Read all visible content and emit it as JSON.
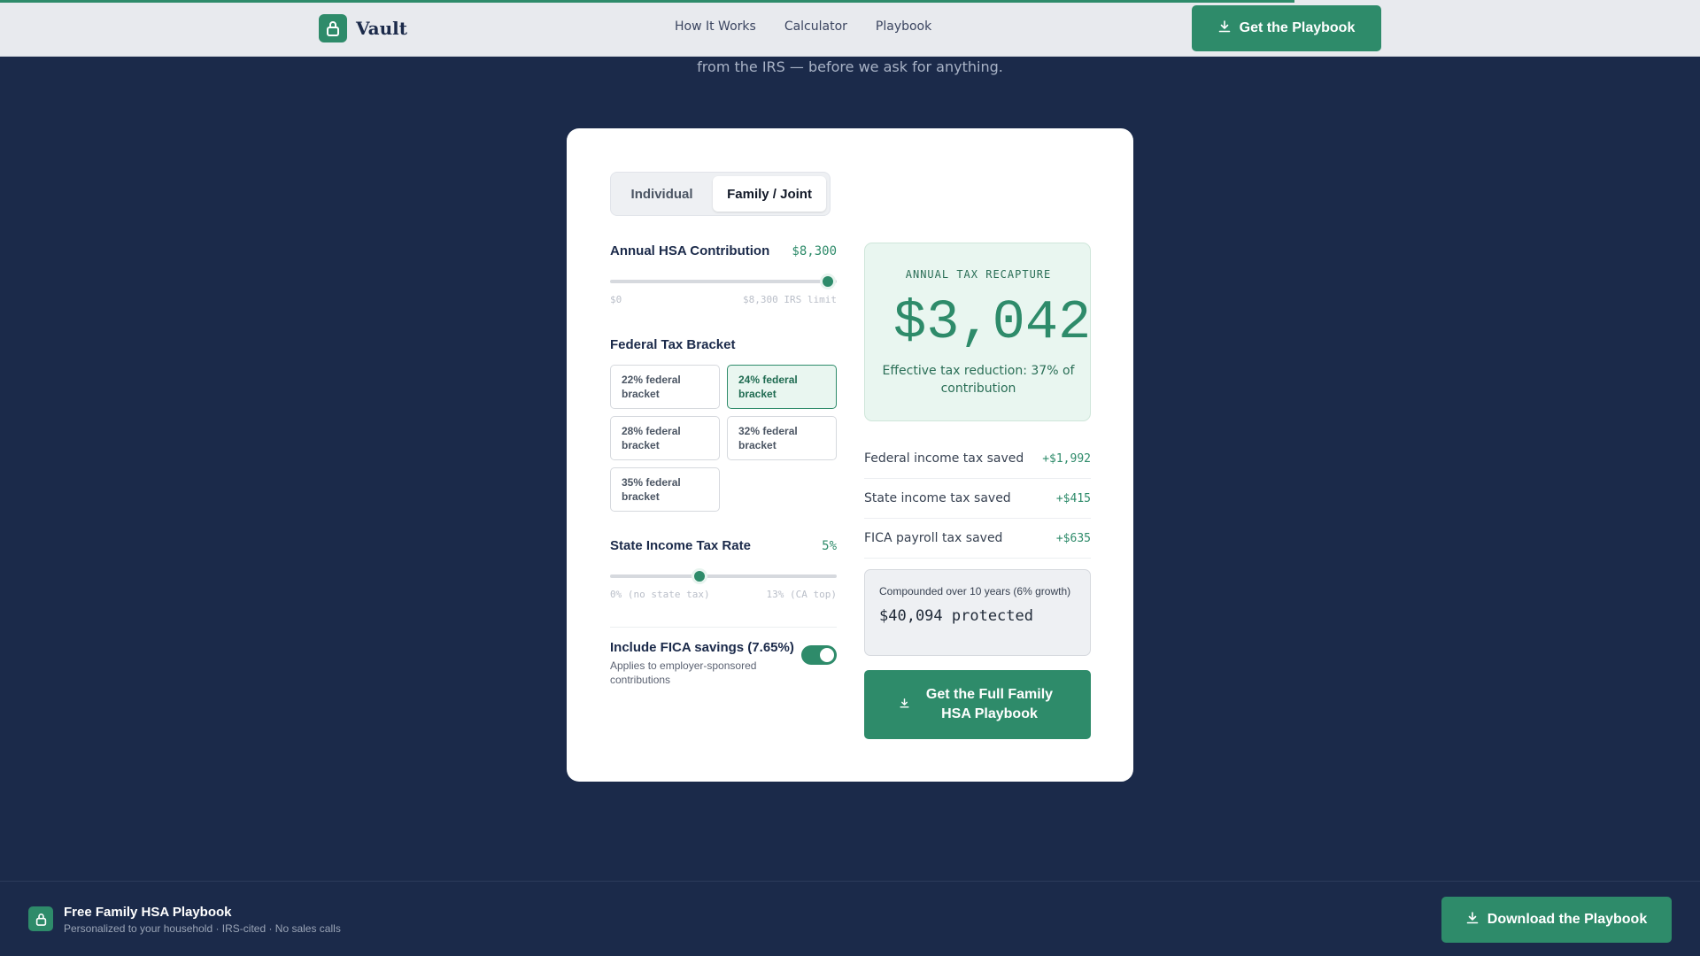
{
  "colors": {
    "brand": "#2e8b6a",
    "navy": "#1b2a4a"
  },
  "header": {
    "brand": "Vault",
    "nav": [
      "How It Works",
      "Calculator",
      "Playbook"
    ],
    "cta_label": "Get the Playbook"
  },
  "subline": "from the IRS — before we ask for anything.",
  "calculator": {
    "tabs": [
      "Individual",
      "Family / Joint"
    ],
    "active_tab": "Family / Joint",
    "contribution": {
      "label": "Annual HSA Contribution",
      "value": "$8,300",
      "level": 1.0,
      "min_label": "$0",
      "max_label": "$8,300 IRS limit"
    },
    "bracket": {
      "label": "Federal Tax Bracket",
      "options": [
        "22% federal bracket",
        "24% federal bracket",
        "28% federal bracket",
        "32% federal bracket",
        "35% federal bracket"
      ],
      "selected": "24% federal bracket"
    },
    "state": {
      "label": "State Income Tax Rate",
      "value": "5%",
      "level": 0.385,
      "min_label": "0% (no state tax)",
      "max_label": "13% (CA top)"
    },
    "fica": {
      "title": "Include FICA savings (7.65%)",
      "subtitle": "Applies to employer-sponsored contributions",
      "enabled": true
    }
  },
  "result": {
    "kicker": "ANNUAL TAX RECAPTURE",
    "amount": "$3,042",
    "note": "Effective tax reduction: 37% of contribution",
    "breakdown": [
      {
        "label": "Federal income tax saved",
        "value": "+$1,992"
      },
      {
        "label": "State income tax saved",
        "value": "+$415"
      },
      {
        "label": "FICA payroll tax saved",
        "value": "+$635"
      }
    ],
    "compound_label": "Compounded over 10 years (6% growth)",
    "compound_value": "$40,094 protected",
    "cta_label": "Get the Full Family HSA Playbook"
  },
  "footer": {
    "title": "Free Family HSA Playbook",
    "subtitle": "Personalized to your household · IRS-cited · No sales calls",
    "cta_label": "Download the Playbook"
  }
}
